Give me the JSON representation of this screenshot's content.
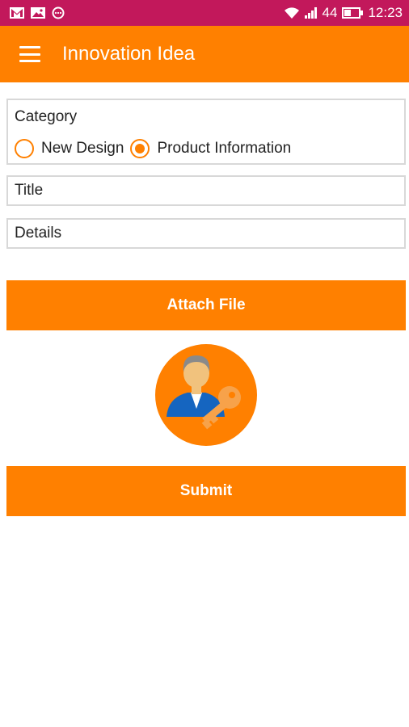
{
  "status_bar": {
    "network": "44",
    "time": "12:23",
    "left_icons": [
      "gmail-icon",
      "gallery-icon",
      "messenger-icon"
    ],
    "right_icons": [
      "wifi-icon",
      "signal-icon",
      "battery-icon"
    ]
  },
  "app_bar": {
    "title": "Innovation Idea",
    "menu_icon": "hamburger-menu-icon",
    "color": "#ff8000"
  },
  "form": {
    "category": {
      "label": "Category",
      "options": [
        {
          "label": "New Design",
          "selected": false
        },
        {
          "label": "Product Information",
          "selected": true
        }
      ]
    },
    "title_placeholder": "Title",
    "details_placeholder": "Details"
  },
  "buttons": {
    "attach_label": "Attach File",
    "submit_label": "Submit"
  },
  "colors": {
    "status_bar": "#c2185b",
    "accent": "#ff8000"
  }
}
